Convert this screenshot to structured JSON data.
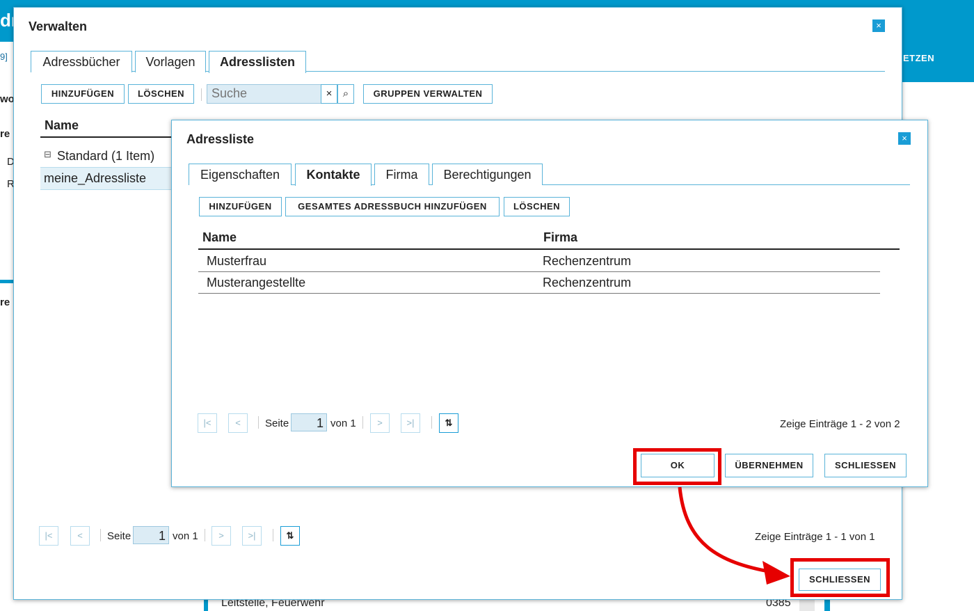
{
  "background": {
    "title_fragment": "dr",
    "left_fragments": [
      "9]",
      "wo",
      "re",
      "D",
      "R",
      "re"
    ],
    "right_label": "ETZEN",
    "bottom_row": {
      "text": "Leitstelle, Feuerwehr",
      "number": "0385"
    }
  },
  "outer_dialog": {
    "title": "Verwalten",
    "close_symbol": "×",
    "tabs": [
      {
        "label": "Adressbücher",
        "active": false
      },
      {
        "label": "Vorlagen",
        "active": false
      },
      {
        "label": "Adresslisten",
        "active": true
      }
    ],
    "toolbar": {
      "add": "HINZUFÜGEN",
      "delete": "LÖSCHEN",
      "search_placeholder": "Suche",
      "search_clear": "×",
      "search_go": "⌕",
      "manage_groups": "GRUPPEN VERWALTEN"
    },
    "column_header": "Name",
    "group": {
      "label": "Standard (1 Item)",
      "toggle": "⊟"
    },
    "rows": [
      "meine_Adressliste"
    ],
    "pager": {
      "page_label": "Seite",
      "page": "1",
      "of_label": "von 1",
      "summary": "Zeige Einträge 1 - 1 von 1"
    },
    "close_button": "SCHLIESSEN"
  },
  "inner_dialog": {
    "title": "Adressliste",
    "close_symbol": "×",
    "tabs": [
      {
        "label": "Eigenschaften",
        "active": false
      },
      {
        "label": "Kontakte",
        "active": true
      },
      {
        "label": "Firma",
        "active": false
      },
      {
        "label": "Berechtigungen",
        "active": false
      }
    ],
    "toolbar": {
      "add": "HINZUFÜGEN",
      "add_all": "GESAMTES ADRESSBUCH HINZUFÜGEN",
      "delete": "LÖSCHEN"
    },
    "columns": {
      "name": "Name",
      "company": "Firma"
    },
    "rows": [
      {
        "name": "Musterfrau",
        "company": "Rechenzentrum"
      },
      {
        "name": "Musterangestellte",
        "company": "Rechenzentrum"
      }
    ],
    "pager": {
      "page_label": "Seite",
      "page": "1",
      "of_label": "von 1",
      "summary": "Zeige Einträge 1 - 2 von 2"
    },
    "buttons": {
      "ok": "OK",
      "apply": "ÜBERNEHMEN",
      "close": "SCHLIESSEN"
    }
  },
  "pager_icons": {
    "first": "|<",
    "prev": "<",
    "next": ">",
    "last": ">|",
    "refresh": "⇅"
  },
  "colors": {
    "accent": "#0099cc",
    "annotation": "#e60000"
  }
}
